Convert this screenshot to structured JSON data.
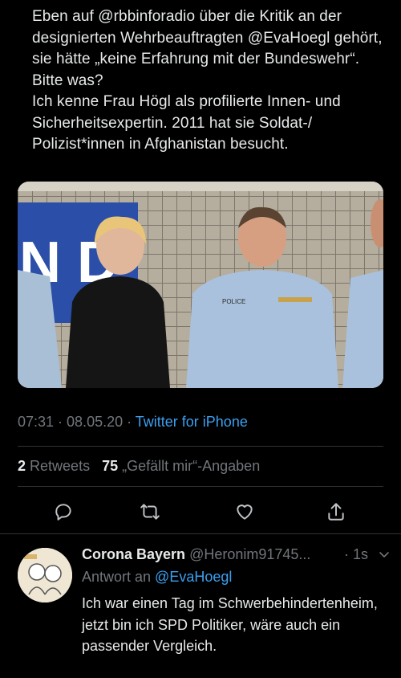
{
  "tweet": {
    "text": "Eben auf @rbbinforadio über die Kritik an der designierten Wehrbeauftragten @EvaHoegl gehört, sie hätte „keine Erfahrung mit der Bundeswehr“.\nBitte was?\nIch kenne Frau Högl als profilierte Innen- und Sicherheitsexpertin. 2011 hat sie Soldat-/ Polizist*innen in Afghanistan besucht.",
    "image": {
      "sign_text": "N D",
      "badge_text": "POLICE"
    },
    "time": "07:31 · 08.05.20 · ",
    "source": "Twitter for iPhone",
    "retweets_count": "2",
    "retweets_label": "Retweets",
    "likes_count": "75",
    "likes_label": "„Gefällt mir“-Angaben"
  },
  "actions": {
    "reply_icon": "reply-icon",
    "retweet_icon": "retweet-icon",
    "like_icon": "heart-icon",
    "share_icon": "share-icon"
  },
  "reply": {
    "name": "Corona Bayern",
    "handle": "@Heronim91745...",
    "time": "· 1s",
    "reply_to_prefix": "Antwort an ",
    "reply_to_mention": "@EvaHoegl",
    "text": "Ich war einen Tag im Schwerbehindertenheim, jetzt bin ich SPD Politiker, wäre auch ein passender Vergleich."
  },
  "colors": {
    "background": "#000000",
    "link": "#3a9ff0",
    "muted": "#71767b",
    "text": "#e7e9ea"
  }
}
